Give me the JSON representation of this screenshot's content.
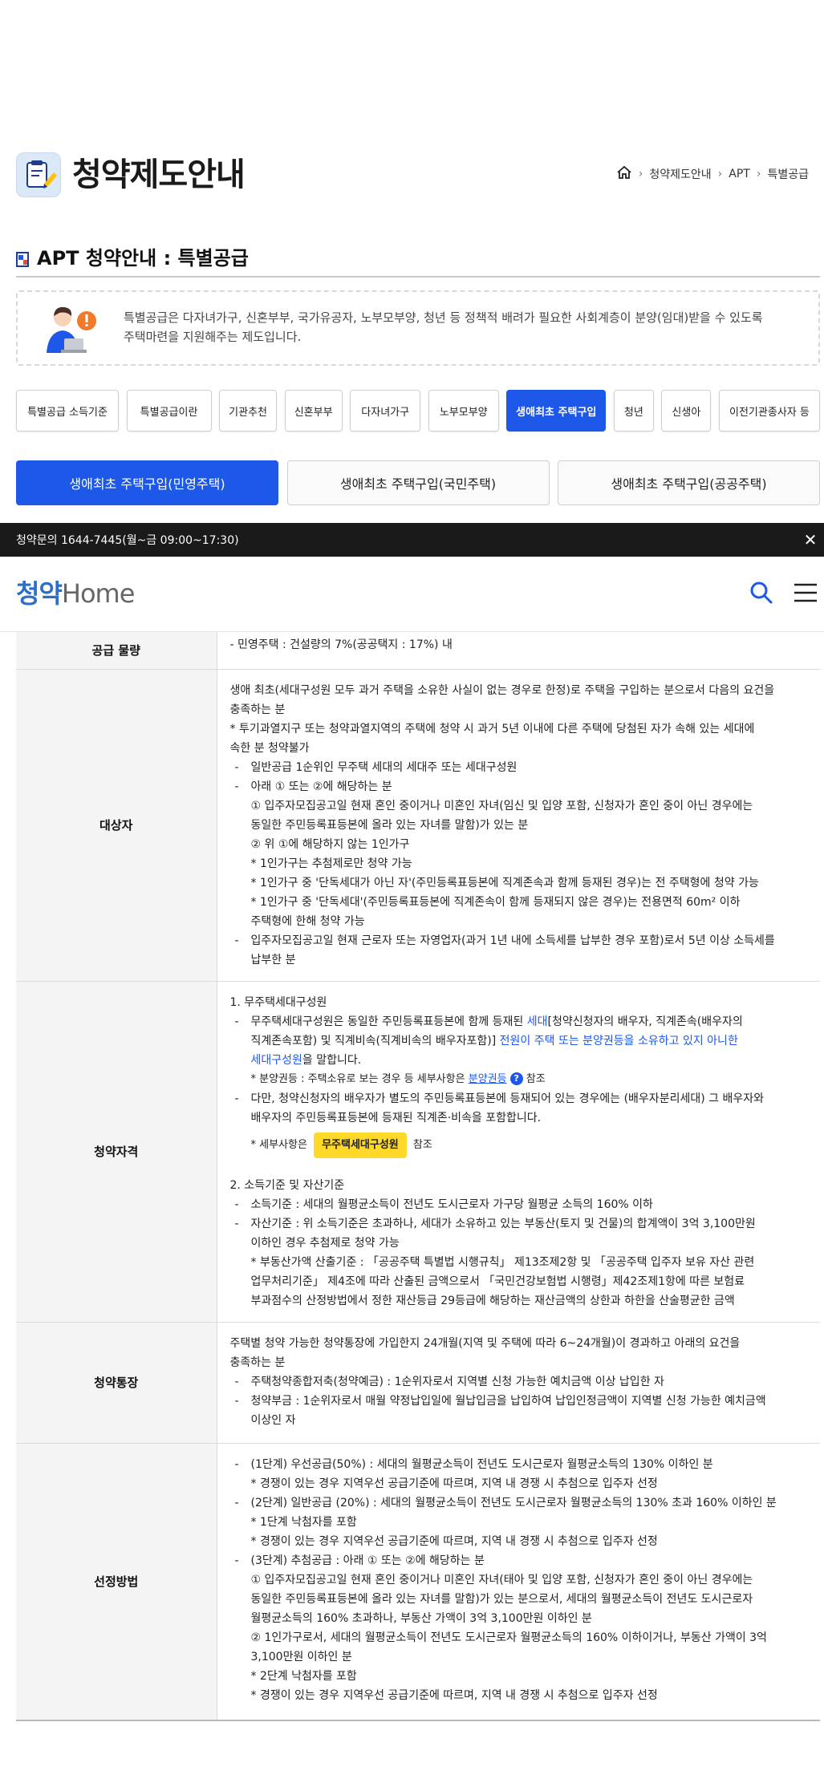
{
  "page": {
    "title": "청약제도안내",
    "breadcrumb": [
      "청약제도안내",
      "APT",
      "특별공급"
    ]
  },
  "section_title": "APT 청약안내 : 특별공급",
  "intro": {
    "line1": "특별공급은 다자녀가구, 신혼부부, 국가유공자, 노부모부양, 청년 등 정책적 배려가 필요한 사회계층이 분양(임대)받을 수 있도록",
    "line2": "주택마련을 지원해주는 제도입니다."
  },
  "tabs": [
    {
      "label": "특별공급 소득기준",
      "active": false
    },
    {
      "label": "특별공급이란",
      "active": false
    },
    {
      "label": "기관추천",
      "active": false
    },
    {
      "label": "신혼부부",
      "active": false
    },
    {
      "label": "다자녀가구",
      "active": false
    },
    {
      "label": "노부모부양",
      "active": false
    },
    {
      "label": "생애최초 주택구입",
      "active": true
    },
    {
      "label": "청년",
      "active": false
    },
    {
      "label": "신생아",
      "active": false
    },
    {
      "label": "이전기관종사자 등",
      "active": false
    }
  ],
  "subtabs": [
    {
      "label": "생애최초 주택구입(민영주택)",
      "active": true
    },
    {
      "label": "생애최초 주택구입(국민주택)",
      "active": false
    },
    {
      "label": "생애최초 주택구입(공공주택)",
      "active": false
    }
  ],
  "topbar": {
    "text": "청약문의 1644-7445(월~금 09:00~17:30)",
    "close": "✕"
  },
  "logo": {
    "part1": "청약",
    "part2": "Home"
  },
  "table": {
    "supply": {
      "head": "공급 물량",
      "line": "- 민영주택 : 건설량의 7%(공공택지 : 17%) 내"
    },
    "target": {
      "head": "대상자",
      "l1": "생애 최초(세대구성원 모두 과거 주택을 소유한 사실이 없는 경우로 한정)로 주택을 구입하는 분으로서 다음의 요건을",
      "l2": "충족하는 분",
      "l3": "* 투기과열지구 또는 청약과열지역의 주택에 청약 시 과거 5년 이내에 다른 주택에 당첨된 자가 속해 있는 세대에",
      "l4": "속한 분 청약불가",
      "b1": "일반공급 1순위인 무주택 세대의 세대주 또는 세대구성원",
      "b2": "아래 ① 또는 ②에 해당하는 분",
      "b2a": "① 입주자모집공고일 현재 혼인 중이거나 미혼인 자녀(임신 및 입양 포함, 신청자가 혼인 중이 아닌 경우에는",
      "b2b": "동일한 주민등록표등본에 올라 있는 자녀를 말함)가 있는 분",
      "b2c": "② 위 ①에 해당하지 않는 1인가구",
      "b2d": "* 1인가구는 추첨제로만 청약 가능",
      "b2e": "* 1인가구 중 '단독세대가 아닌 자'(주민등록표등본에 직계존속과 함께 등재된 경우)는 전 주택형에 청약 가능",
      "b2f": "* 1인가구 중 '단독세대'(주민등록표등본에 직계존속이 함께 등재되지 않은 경우)는 전용면적 60m² 이하",
      "b2g": "주택형에 한해 청약 가능",
      "b3a": "입주자모집공고일 현재 근로자 또는 자영업자(과거 1년 내에 소득세를 납부한 경우 포함)로서 5년 이상 소득세를",
      "b3b": "납부한 분"
    },
    "qual": {
      "head": "청약자격",
      "h1": "1. 무주택세대구성원",
      "a1": "무주택세대구성원은 동일한 주민등록표등본에 함께 등재된 ",
      "a1_blue": "세대",
      "a1_rest": "[청약신청자의 배우자, 직계존속(배우자의",
      "a2": "직계존속포함) 및 직계비속(직계비속의 배우자포함)] ",
      "a2_blue": "전원이 주택 또는 분양권등을 소유하고 있지 아니한",
      "a3_blue": "세대구성원",
      "a3_rest": "을 말합니다.",
      "n1": "* 분양권등 : 주택소유로 보는 경우 등 세부사항은 ",
      "n1_link": "분양권등",
      "n1_rest": " 참조",
      "q": "?",
      "b1": "다만, 청약신청자의 배우자가 별도의 주민등록표등본에 등재되어 있는 경우에는 (배우자분리세대) 그 배우자와",
      "b2": "배우자의 주민등록표등본에 등재된 직계존·비속을 포함합니다.",
      "n2": "* 세부사항은 ",
      "n2_btn": "무주택세대구성원",
      "n2_rest": " 참조",
      "h2": "2. 소득기준 및 자산기준",
      "c1": "소득기준 : 세대의 월평균소득이 전년도 도시근로자 가구당 월평균 소득의 160% 이하",
      "c2a": "자산기준 : 위 소득기준은 초과하나, 세대가 소유하고 있는 부동산(토지 및 건물)의 합계액이 3억 3,100만원",
      "c2b": "이하인 경우 추첨제로 청약 가능",
      "c3a": "* 부동산가액 산출기준 : 「공공주택 특별법 시행규칙」 제13조제2항 및 「공공주택 입주자 보유 자산 관련",
      "c3b": "업무처리기준」 제4조에 따라 산출된 금액으로서 「국민건강보험법 시행령」제42조제1항에 따른 보험료",
      "c3c": "부과점수의 산정방법에서 정한 재산등급 29등급에 해당하는 재산금액의 상한과 하한을 산술평균한 금액"
    },
    "account": {
      "head": "청약통장",
      "l1": "주택별 청약 가능한 청약통장에 가입한지 24개월(지역 및 주택에 따라 6~24개월)이 경과하고 아래의 요건을",
      "l2": "충족하는 분",
      "b1": "주택청약종합저축(청약예금) : 1순위자로서 지역별 신청 가능한 예치금액 이상 납입한 자",
      "b2a": "청약부금 : 1순위자로서 매월 약정납입일에 월납입금을 납입하여 납입인정금액이 지역별 신청 가능한 예치금액",
      "b2b": "이상인 자"
    },
    "method": {
      "head": "선정방법",
      "s1": "(1단계) 우선공급(50%) : 세대의 월평균소득이 전년도 도시근로자 월평균소득의 130% 이하인 분",
      "s1n": "* 경쟁이 있는 경우 지역우선 공급기준에 따르며, 지역 내 경쟁 시 추첨으로 입주자 선정",
      "s2": "(2단계) 일반공급 (20%) : 세대의 월평균소득이 전년도 도시근로자 월평균소득의 130% 초과 160% 이하인 분",
      "s2n1": "* 1단계 낙첨자를 포함",
      "s2n2": "* 경쟁이 있는 경우 지역우선 공급기준에 따르며, 지역 내 경쟁 시 추첨으로 입주자 선정",
      "s3": "(3단계) 추첨공급 : 아래 ① 또는 ②에 해당하는 분",
      "s3a": "① 입주자모집공고일 현재 혼인 중이거나 미혼인 자녀(태아 및 입양 포함, 신청자가 혼인 중이 아닌 경우에는",
      "s3b": "동일한 주민등록표등본에 올라 있는 자녀를 말함)가 있는 분으로서, 세대의 월평균소득이 전년도 도시근로자",
      "s3c": "월평균소득의 160% 초과하나, 부동산 가액이 3억 3,100만원 이하인 분",
      "s3d": "② 1인가구로서, 세대의 월평균소득이 전년도 도시근로자 월평균소득의 160% 이하이거나, 부동산 가액이 3억",
      "s3e": "3,100만원 이하인 분",
      "s3n1": "* 2단계 낙첨자를 포함",
      "s3n2": "* 경쟁이 있는 경우 지역우선 공급기준에 따르며, 지역 내 경쟁 시 추첨으로 입주자 선정"
    }
  },
  "colors": {
    "primary": "#1d58e8",
    "highlight": "#ffd92a",
    "topbar": "#1a1a1a"
  }
}
